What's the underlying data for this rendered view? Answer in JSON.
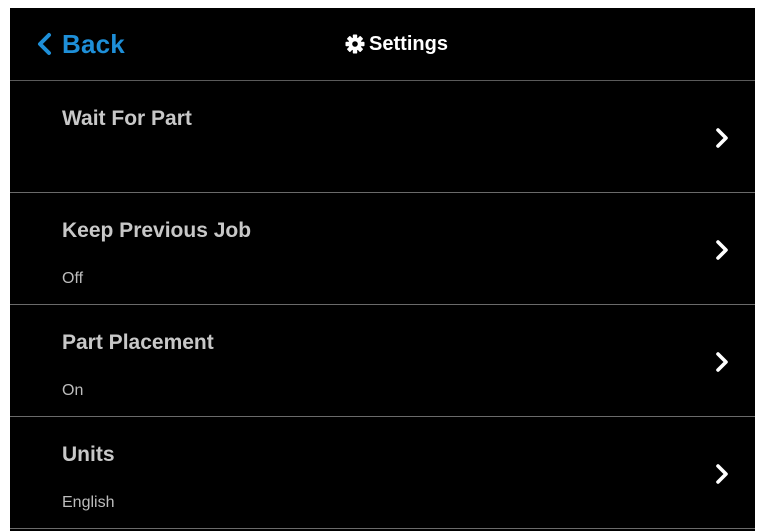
{
  "header": {
    "back_label": "Back",
    "title": "Settings",
    "title_icon": "gear-icon",
    "back_icon": "chevron-left-icon",
    "accent_color": "#1e8fd8"
  },
  "settings": {
    "items": [
      {
        "label": "Wait For Part",
        "value": ""
      },
      {
        "label": "Keep Previous Job",
        "value": "Off"
      },
      {
        "label": "Part Placement",
        "value": "On"
      },
      {
        "label": "Units",
        "value": "English"
      }
    ],
    "row_icon": "chevron-right-icon"
  },
  "colors": {
    "background": "#000000",
    "label_text": "#c8c8c8",
    "value_text": "#bdbdbd",
    "divider": "#6a6a6a"
  }
}
